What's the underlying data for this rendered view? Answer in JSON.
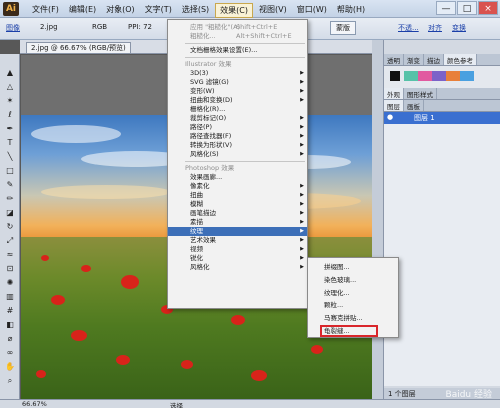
{
  "app": {
    "logo": "Ai"
  },
  "menu": [
    "文件(F)",
    "编辑(E)",
    "对象(O)",
    "文字(T)",
    "选择(S)",
    "效果(C)",
    "视图(V)",
    "窗口(W)",
    "帮助(H)"
  ],
  "menu_active_index": 5,
  "window_controls": [
    "—",
    "□",
    "×"
  ],
  "controlbar": {
    "label": "图像",
    "filename": "2.jpg",
    "colormode": "RGB",
    "ppi": "PPI: 72",
    "button": "蒙版",
    "links": [
      "不透...",
      "对齐",
      "变换"
    ]
  },
  "doc_tab": "2.jpg @ 66.67% (RGB/预览)",
  "dropdown": {
    "top_items": [
      {
        "label": "应用 \"粗糙化\"(A)",
        "shortcut": "Shift+Ctrl+E",
        "disabled": true
      },
      {
        "label": "粗糙化...",
        "shortcut": "Alt+Shift+Ctrl+E",
        "disabled": true
      }
    ],
    "doc_settings": "文档栅格效果设置(E)...",
    "illustrator_header": "Illustrator 效果",
    "illustrator_items": [
      "3D(3)",
      "SVG 滤镜(G)",
      "变形(W)",
      "扭曲和变换(D)",
      "栅格化(R)...",
      "裁剪标记(O)",
      "路径(P)",
      "路径查找器(F)",
      "转换为形状(V)",
      "风格化(S)"
    ],
    "photoshop_header": "Photoshop 效果",
    "photoshop_items": [
      "效果画廊...",
      "像素化",
      "扭曲",
      "模糊",
      "画笔描边",
      "素描",
      "纹理",
      "艺术效果",
      "视频",
      "锐化",
      "风格化"
    ],
    "highlight": "纹理"
  },
  "submenu": [
    "拼缀图...",
    "染色玻璃...",
    "纹理化...",
    "颗粒...",
    "马赛克拼贴...",
    "龟裂缝..."
  ],
  "submenu_boxed": "龟裂缝...",
  "panels": {
    "top_tabs": [
      "透明",
      "渐变",
      "描边",
      "颜色参考"
    ],
    "mid_tabs": [
      "外观",
      "图形样式"
    ],
    "layer_tabs": [
      "图层",
      "画板"
    ],
    "layer_name": "图层 1",
    "layer_count": "1 个图层"
  },
  "status": {
    "zoom": "66.67%",
    "mode": "选择"
  },
  "watermark": "Baidu 经验",
  "colors": {
    "accent": "#3d6fb8",
    "highlight_box": "#d9262b"
  }
}
